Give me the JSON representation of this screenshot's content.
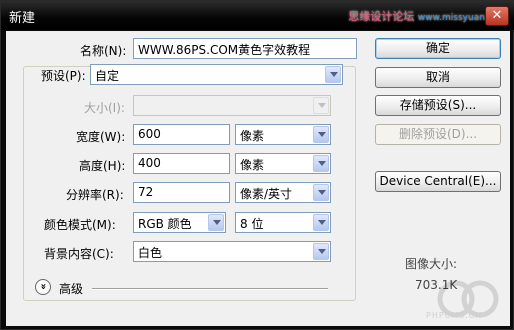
{
  "window": {
    "title": "新建",
    "watermark": "思缘设计论坛",
    "watermark_site": "www.missyuan.com",
    "close_glyph": "✕"
  },
  "form": {
    "name_label": "名称(N):",
    "name_value": "WWW.86PS.COM黄色字效教程",
    "preset_label": "预设(P):",
    "preset_value": "自定",
    "size_label": "大小(I):",
    "size_value": "",
    "width_label": "宽度(W):",
    "width_value": "600",
    "width_unit": "像素",
    "height_label": "高度(H):",
    "height_value": "400",
    "height_unit": "像素",
    "resolution_label": "分辨率(R):",
    "resolution_value": "72",
    "resolution_unit": "像素/英寸",
    "color_mode_label": "颜色模式(M):",
    "color_mode_value": "RGB 颜色",
    "bit_depth_value": "8 位",
    "background_label": "背景内容(C):",
    "background_value": "白色",
    "advanced_label": "高级",
    "advanced_glyph": "»"
  },
  "buttons": {
    "ok": "确定",
    "cancel": "取消",
    "save_preset": "存储预设(S)...",
    "delete_preset": "删除预设(D)...",
    "device_central": "Device Central(E)..."
  },
  "image_size": {
    "label": "图像大小:",
    "value": "703.1K"
  },
  "watermark_footer": "PHPCMS.CN"
}
